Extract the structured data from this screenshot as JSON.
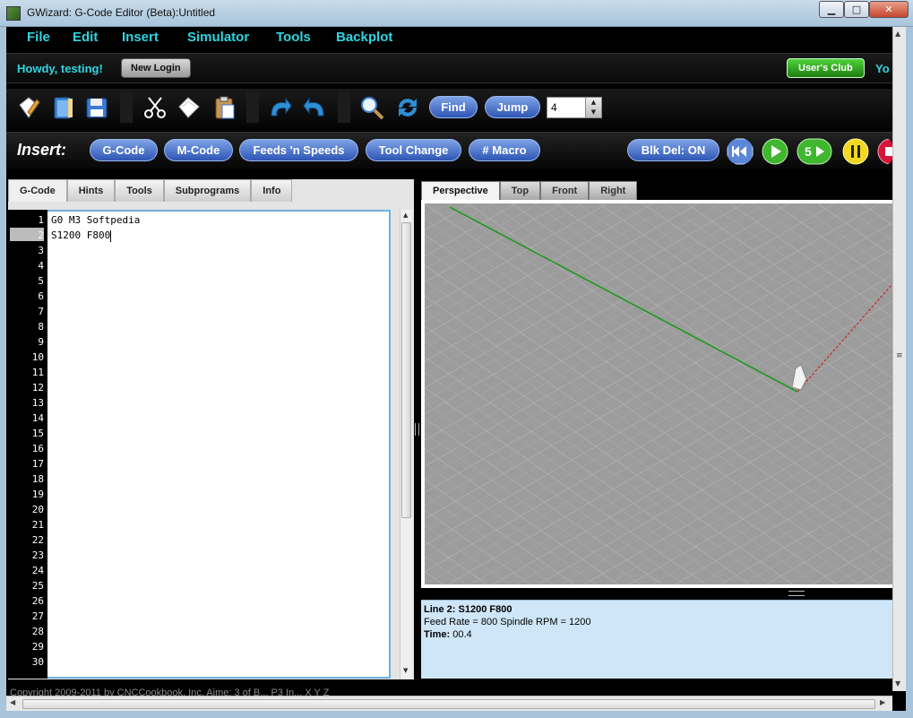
{
  "window": {
    "title": "GWizard: G-Code Editor (Beta):Untitled",
    "minimize": "▁",
    "maximize": "□",
    "close": "✕"
  },
  "menu": [
    "File",
    "Edit",
    "Insert",
    "Simulator",
    "Tools",
    "Backplot"
  ],
  "login": {
    "greeting": "Howdy, testing!",
    "new_login": "New Login",
    "users_club": "User's Club",
    "truncated": "Yo"
  },
  "toolbar": {
    "icons": [
      "new-document-icon",
      "open-book-icon",
      "save-disk-icon",
      "cut-scissors-icon",
      "copy-icon",
      "paste-clipboard-icon",
      "undo-icon",
      "redo-icon",
      "search-icon",
      "refresh-icon"
    ],
    "find": "Find",
    "jump": "Jump",
    "jump_value": "4"
  },
  "insert": {
    "label": "Insert:",
    "buttons": [
      "G-Code",
      "M-Code",
      "Feeds 'n Speeds",
      "Tool Change",
      "# Macro"
    ],
    "blk_del": "Blk Del: ON",
    "controls": [
      "rewind-icon",
      "play-icon",
      "step-play-icon",
      "pause-icon",
      "stop-icon"
    ],
    "step_label": "5"
  },
  "left_tabs": [
    "G-Code",
    "Hints",
    "Tools",
    "Subprograms",
    "Info"
  ],
  "editor": {
    "lines": [
      "G0 M3 Softpedia",
      "S1200 F800"
    ],
    "current_line": 2,
    "line_numbers": [
      "1",
      "2",
      "3",
      "4",
      "5",
      "6",
      "7",
      "8",
      "9",
      "10",
      "11",
      "12",
      "13",
      "14",
      "15",
      "16",
      "17",
      "18",
      "19",
      "20",
      "21",
      "22",
      "23",
      "24",
      "25",
      "26",
      "27",
      "28",
      "29",
      "30"
    ]
  },
  "view_tabs": [
    "Perspective",
    "Top",
    "Front",
    "Right"
  ],
  "info": {
    "line": "Line 2: S1200 F800",
    "feed": "Feed Rate = 800 Spindle RPM = 1200",
    "time_label": "Time:",
    "time_value": "00.4"
  },
  "footer": "Copyright 2009-2011 by CNCCookbook, Inc.  Aime: 3 of B... P3 In...          X          Y          Z",
  "colors": {
    "menu_text": "#2fd5e0",
    "button_blue": "#2e56b5",
    "path_green": "#1e9a1e",
    "path_red": "#c83232",
    "grid_bg": "#9c9c9c",
    "info_bg": "#cfe6f8"
  }
}
